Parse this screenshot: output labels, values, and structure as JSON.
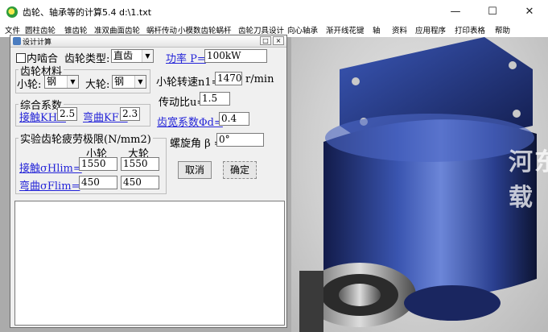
{
  "window": {
    "title": "齿轮、轴承等的计算5.4   d:\\1.txt",
    "minimize": "—",
    "maximize": "☐",
    "close": "✕"
  },
  "menu": [
    "文件",
    "圆柱齿轮",
    "锥齿轮",
    "准双曲面齿轮",
    "蜗杆传动",
    "小模数齿轮蜗杆",
    "齿轮刀具设计",
    "向心轴承",
    "渐开线花键",
    "轴",
    "资料",
    "应用程序",
    "打印表格",
    "帮助"
  ],
  "dialog": {
    "title": "设计计算",
    "internal_gear_label": "内啮合",
    "gear_type_label": "齿轮类型:",
    "gear_type_value": "直齿",
    "power_label": "功率 P=",
    "power_value": "100kW",
    "material_group": "齿轮材料",
    "small_gear_label": "小轮:",
    "small_gear_material": "钢",
    "large_gear_label": "大轮:",
    "large_gear_material": "钢",
    "speed_label": "小轮转速n1=",
    "speed_value": "1470",
    "speed_unit": "r/min",
    "factor_group": "综合系数",
    "contact_k_label": "接触KH=",
    "contact_k_value": "2.5",
    "bending_k_label": "弯曲KF=",
    "bending_k_value": "2.3",
    "ratio_label": "传动比u=",
    "ratio_value": "1.5",
    "width_coef_label": "齿宽系数Φd=",
    "width_coef_value": "0.4",
    "fatigue_group": "实验齿轮疲劳极限(N/mm2)",
    "col_small": "小轮",
    "col_large": "大轮",
    "contact_lim_label": "接触σHlim=",
    "contact_lim_small": "1550",
    "contact_lim_large": "1550",
    "bending_lim_label": "弯曲σFlim=",
    "bending_lim_small": "450",
    "bending_lim_large": "450",
    "helix_label": "螺旋角 β =",
    "helix_value": "0°",
    "cancel_button": "取消",
    "ok_button": "确定",
    "restore_icon": "□",
    "close_icon": "×"
  },
  "watermark": "河东 xx下载",
  "colors": {
    "link": "#2525d8",
    "dialog_bg": "#f0f0f0",
    "motor_blue": "#1e2f7a"
  }
}
